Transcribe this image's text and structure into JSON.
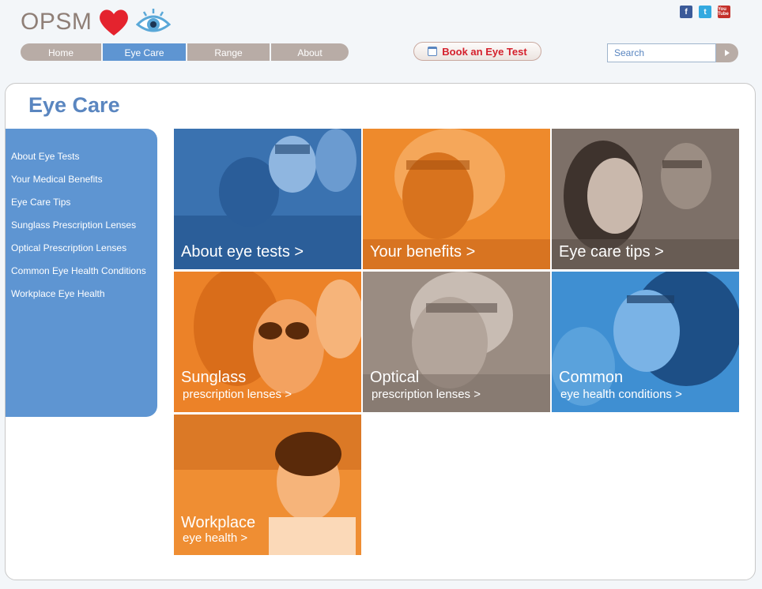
{
  "brand": {
    "name": "OPSM"
  },
  "social": {
    "facebook": "f",
    "twitter": "t",
    "youtube": "You Tube"
  },
  "nav": {
    "items": [
      {
        "label": "Home",
        "active": false
      },
      {
        "label": "Eye Care",
        "active": true
      },
      {
        "label": "Range",
        "active": false
      },
      {
        "label": "About",
        "active": false
      }
    ]
  },
  "book": {
    "label": "Book an Eye Test"
  },
  "search": {
    "placeholder": "Search"
  },
  "page": {
    "title": "Eye Care"
  },
  "sidebar": {
    "items": [
      {
        "label": "About Eye Tests"
      },
      {
        "label": "Your Medical Benefits"
      },
      {
        "label": "Eye Care Tips"
      },
      {
        "label": "Sunglass Prescription Lenses"
      },
      {
        "label": "Optical Prescription Lenses"
      },
      {
        "label": "Common Eye Health Conditions"
      },
      {
        "label": "Workplace Eye Health"
      }
    ]
  },
  "tiles": [
    {
      "line1": "About eye tests >",
      "line2": "",
      "color": "#3f78b8"
    },
    {
      "line1": "Your benefits >",
      "line2": "",
      "color": "#ee8a2c"
    },
    {
      "line1": "Eye care tips >",
      "line2": "",
      "color": "#8a7c72"
    },
    {
      "line1": "Sunglass",
      "line2": "prescription lenses >",
      "color": "#ee8a2c"
    },
    {
      "line1": "Optical",
      "line2": "prescription lenses >",
      "color": "#9a8c82"
    },
    {
      "line1": "Common",
      "line2": "eye health conditions >",
      "color": "#3f8fd2"
    },
    {
      "line1": "Workplace",
      "line2": "eye health >",
      "color": "#ef8e33"
    }
  ],
  "colors": {
    "accent": "#5e95d2",
    "nav_bg": "#b8aca6",
    "book_text": "#d4202c"
  }
}
